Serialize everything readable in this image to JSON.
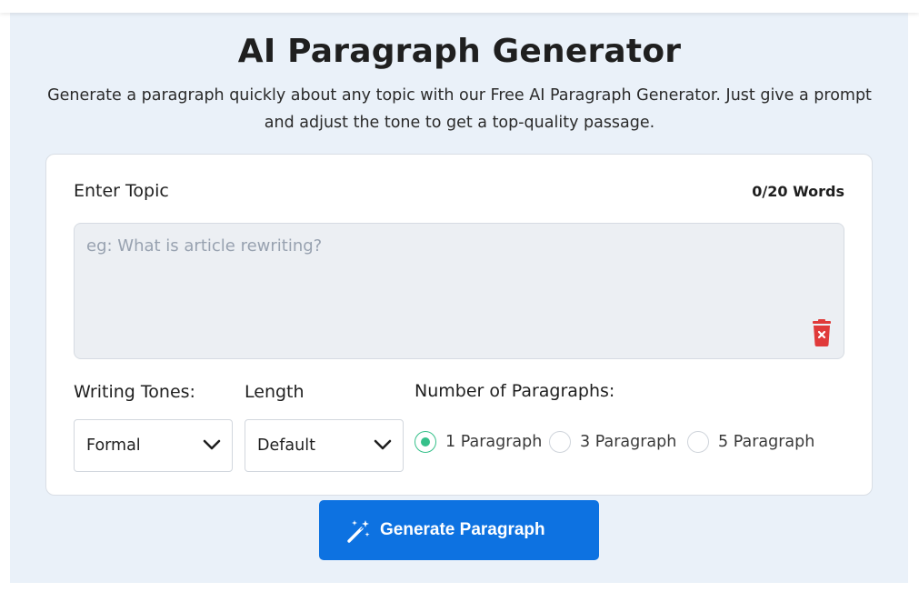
{
  "page": {
    "title": "AI Paragraph Generator",
    "subtitle": "Generate a paragraph quickly about any topic with our Free AI Paragraph Generator. Just give a prompt and adjust the tone to get a top-quality passage."
  },
  "form": {
    "topic_label": "Enter Topic",
    "word_count": "0/20 Words",
    "topic_value": "",
    "topic_placeholder": "eg: What is article rewriting?",
    "tones_label": "Writing Tones:",
    "tone_selected": "Formal",
    "length_label": "Length",
    "length_selected": "Default",
    "paragraphs_label": "Number of Paragraphs:",
    "paragraph_options": [
      {
        "label": "1 Paragraph",
        "checked": true
      },
      {
        "label": "3 Paragraph",
        "checked": false
      },
      {
        "label": "5 Paragraph",
        "checked": false
      }
    ]
  },
  "actions": {
    "generate_label": "Generate Paragraph"
  },
  "icons": {
    "clear": "trash-icon",
    "dropdown": "chevron-down-icon",
    "generate": "magic-wand-icon"
  },
  "colors": {
    "accent": "#0d72e1",
    "radio_active": "#36c08a",
    "delete": "#e03a3a",
    "panel_bg": "#eaf1f9"
  }
}
